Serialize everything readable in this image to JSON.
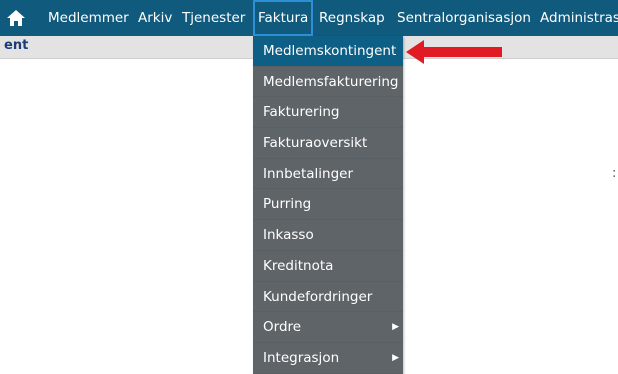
{
  "nav": {
    "home_icon": "home-icon",
    "items": [
      {
        "label": "Medlemmer"
      },
      {
        "label": "Arkiv"
      },
      {
        "label": "Tjenester"
      },
      {
        "label": "Faktura"
      },
      {
        "label": "Regnskap"
      },
      {
        "label": "Sentralorganisasjon"
      },
      {
        "label": "Administrasjon"
      }
    ]
  },
  "subheader": {
    "text": "ent"
  },
  "dropdown": {
    "items": [
      {
        "label": "Medlemskontingent"
      },
      {
        "label": "Medlemsfakturering"
      },
      {
        "label": "Fakturering"
      },
      {
        "label": "Fakturaoversikt"
      },
      {
        "label": "Innbetalinger"
      },
      {
        "label": "Purring"
      },
      {
        "label": "Inkasso"
      },
      {
        "label": "Kreditnota"
      },
      {
        "label": "Kundefordringer"
      },
      {
        "label": "Ordre"
      },
      {
        "label": "Integrasjon"
      }
    ]
  },
  "page_edge_text": ":",
  "colors": {
    "topbar": "#0f5a7d",
    "dropdown_bg": "#5f6468",
    "highlight": "#0e5f86",
    "annotation_arrow": "#e01b24"
  }
}
